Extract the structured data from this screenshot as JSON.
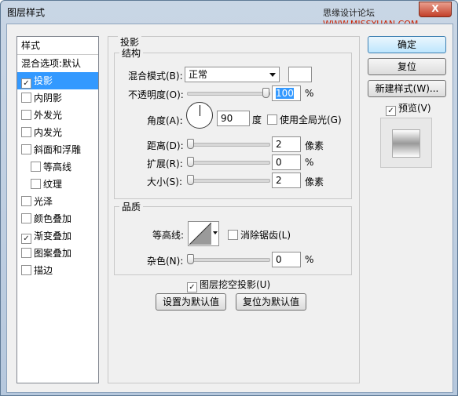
{
  "window": {
    "title": "图层样式",
    "watermark_a": "思缘设计论坛 ",
    "watermark_b": "WWW.MISSYUAN.COM",
    "close": "X"
  },
  "style_list": {
    "header": "样式",
    "items": [
      {
        "label": "混合选项:默认",
        "checkbox": false,
        "checked": false,
        "selected": false,
        "indent": false
      },
      {
        "label": "投影",
        "checkbox": true,
        "checked": true,
        "selected": true,
        "indent": false
      },
      {
        "label": "内阴影",
        "checkbox": true,
        "checked": false,
        "selected": false,
        "indent": false
      },
      {
        "label": "外发光",
        "checkbox": true,
        "checked": false,
        "selected": false,
        "indent": false
      },
      {
        "label": "内发光",
        "checkbox": true,
        "checked": false,
        "selected": false,
        "indent": false
      },
      {
        "label": "斜面和浮雕",
        "checkbox": true,
        "checked": false,
        "selected": false,
        "indent": false
      },
      {
        "label": "等高线",
        "checkbox": true,
        "checked": false,
        "selected": false,
        "indent": true
      },
      {
        "label": "纹理",
        "checkbox": true,
        "checked": false,
        "selected": false,
        "indent": true
      },
      {
        "label": "光泽",
        "checkbox": true,
        "checked": false,
        "selected": false,
        "indent": false
      },
      {
        "label": "颜色叠加",
        "checkbox": true,
        "checked": false,
        "selected": false,
        "indent": false
      },
      {
        "label": "渐变叠加",
        "checkbox": true,
        "checked": true,
        "selected": false,
        "indent": false
      },
      {
        "label": "图案叠加",
        "checkbox": true,
        "checked": false,
        "selected": false,
        "indent": false
      },
      {
        "label": "描边",
        "checkbox": true,
        "checked": false,
        "selected": false,
        "indent": false
      }
    ]
  },
  "shadow": {
    "title": "投影",
    "structure": {
      "title": "结构",
      "blend_mode_label": "混合模式(B):",
      "blend_mode_value": "正常",
      "opacity_label": "不透明度(O):",
      "opacity_value": "100",
      "opacity_level": 100,
      "angle_label": "角度(A):",
      "angle_value": "90",
      "angle_unit": "度",
      "global_light_label": "使用全局光(G)",
      "global_light_checked": false,
      "distance_label": "距离(D):",
      "distance_value": "2",
      "spread_label": "扩展(R):",
      "spread_value": "0",
      "size_label": "大小(S):",
      "size_value": "2",
      "unit_px": "像素",
      "unit_pct": "%"
    },
    "quality": {
      "title": "品质",
      "contour_label": "等高线:",
      "antialias_label": "消除锯齿(L)",
      "antialias_checked": false,
      "noise_label": "杂色(N):",
      "noise_value": "0",
      "unit_pct": "%"
    },
    "knockout_label": "图层挖空投影(U)",
    "knockout_checked": true,
    "make_default": "设置为默认值",
    "reset_default": "复位为默认值"
  },
  "buttons": {
    "ok": "确定",
    "reset": "复位",
    "new_style": "新建样式(W)...",
    "preview_label": "预览(V)",
    "preview_checked": true
  },
  "check_mark": "✓"
}
